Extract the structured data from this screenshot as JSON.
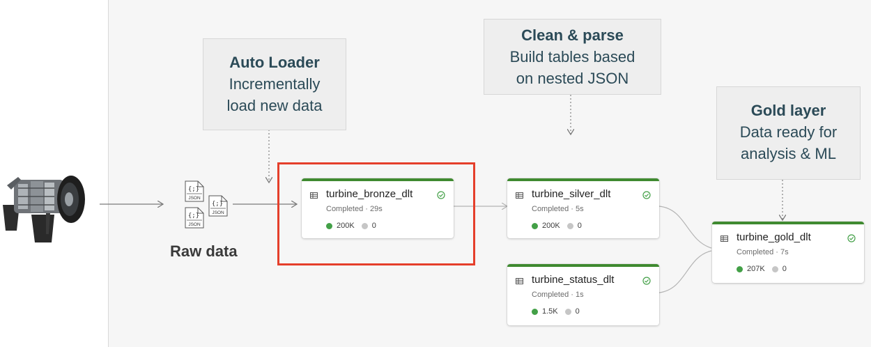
{
  "source": {
    "icon": "turbine-engine-icon"
  },
  "raw_data": {
    "label": "Raw data",
    "files": [
      {
        "icon": "json-file-icon",
        "braces": "{;}",
        "ext": "JSON"
      },
      {
        "icon": "json-file-icon",
        "braces": "{;}",
        "ext": "JSON"
      },
      {
        "icon": "json-file-icon",
        "braces": "{;}",
        "ext": "JSON"
      }
    ]
  },
  "callouts": {
    "auto_loader": {
      "title": "Auto Loader",
      "lines": [
        "Incrementally",
        "load new data"
      ]
    },
    "clean_parse": {
      "title": "Clean & parse",
      "lines": [
        "Build tables based",
        "on nested JSON"
      ]
    },
    "gold_layer": {
      "title": "Gold layer",
      "lines": [
        "Data ready for",
        "analysis & ML"
      ]
    }
  },
  "tables": {
    "bronze": {
      "name": "turbine_bronze_dlt",
      "status": "Completed · 29s",
      "rows_written": "200K",
      "rows_dropped": "0"
    },
    "silver": {
      "name": "turbine_silver_dlt",
      "status": "Completed · 5s",
      "rows_written": "200K",
      "rows_dropped": "0"
    },
    "status": {
      "name": "turbine_status_dlt",
      "status": "Completed · 1s",
      "rows_written": "1.5K",
      "rows_dropped": "0"
    },
    "gold": {
      "name": "turbine_gold_dlt",
      "status": "Completed · 7s",
      "rows_written": "207K",
      "rows_dropped": "0"
    }
  },
  "colors": {
    "card_accent": "#3f8a30",
    "success": "#43a047",
    "highlight": "#e53f2b",
    "callout_text": "#2b4a57"
  }
}
